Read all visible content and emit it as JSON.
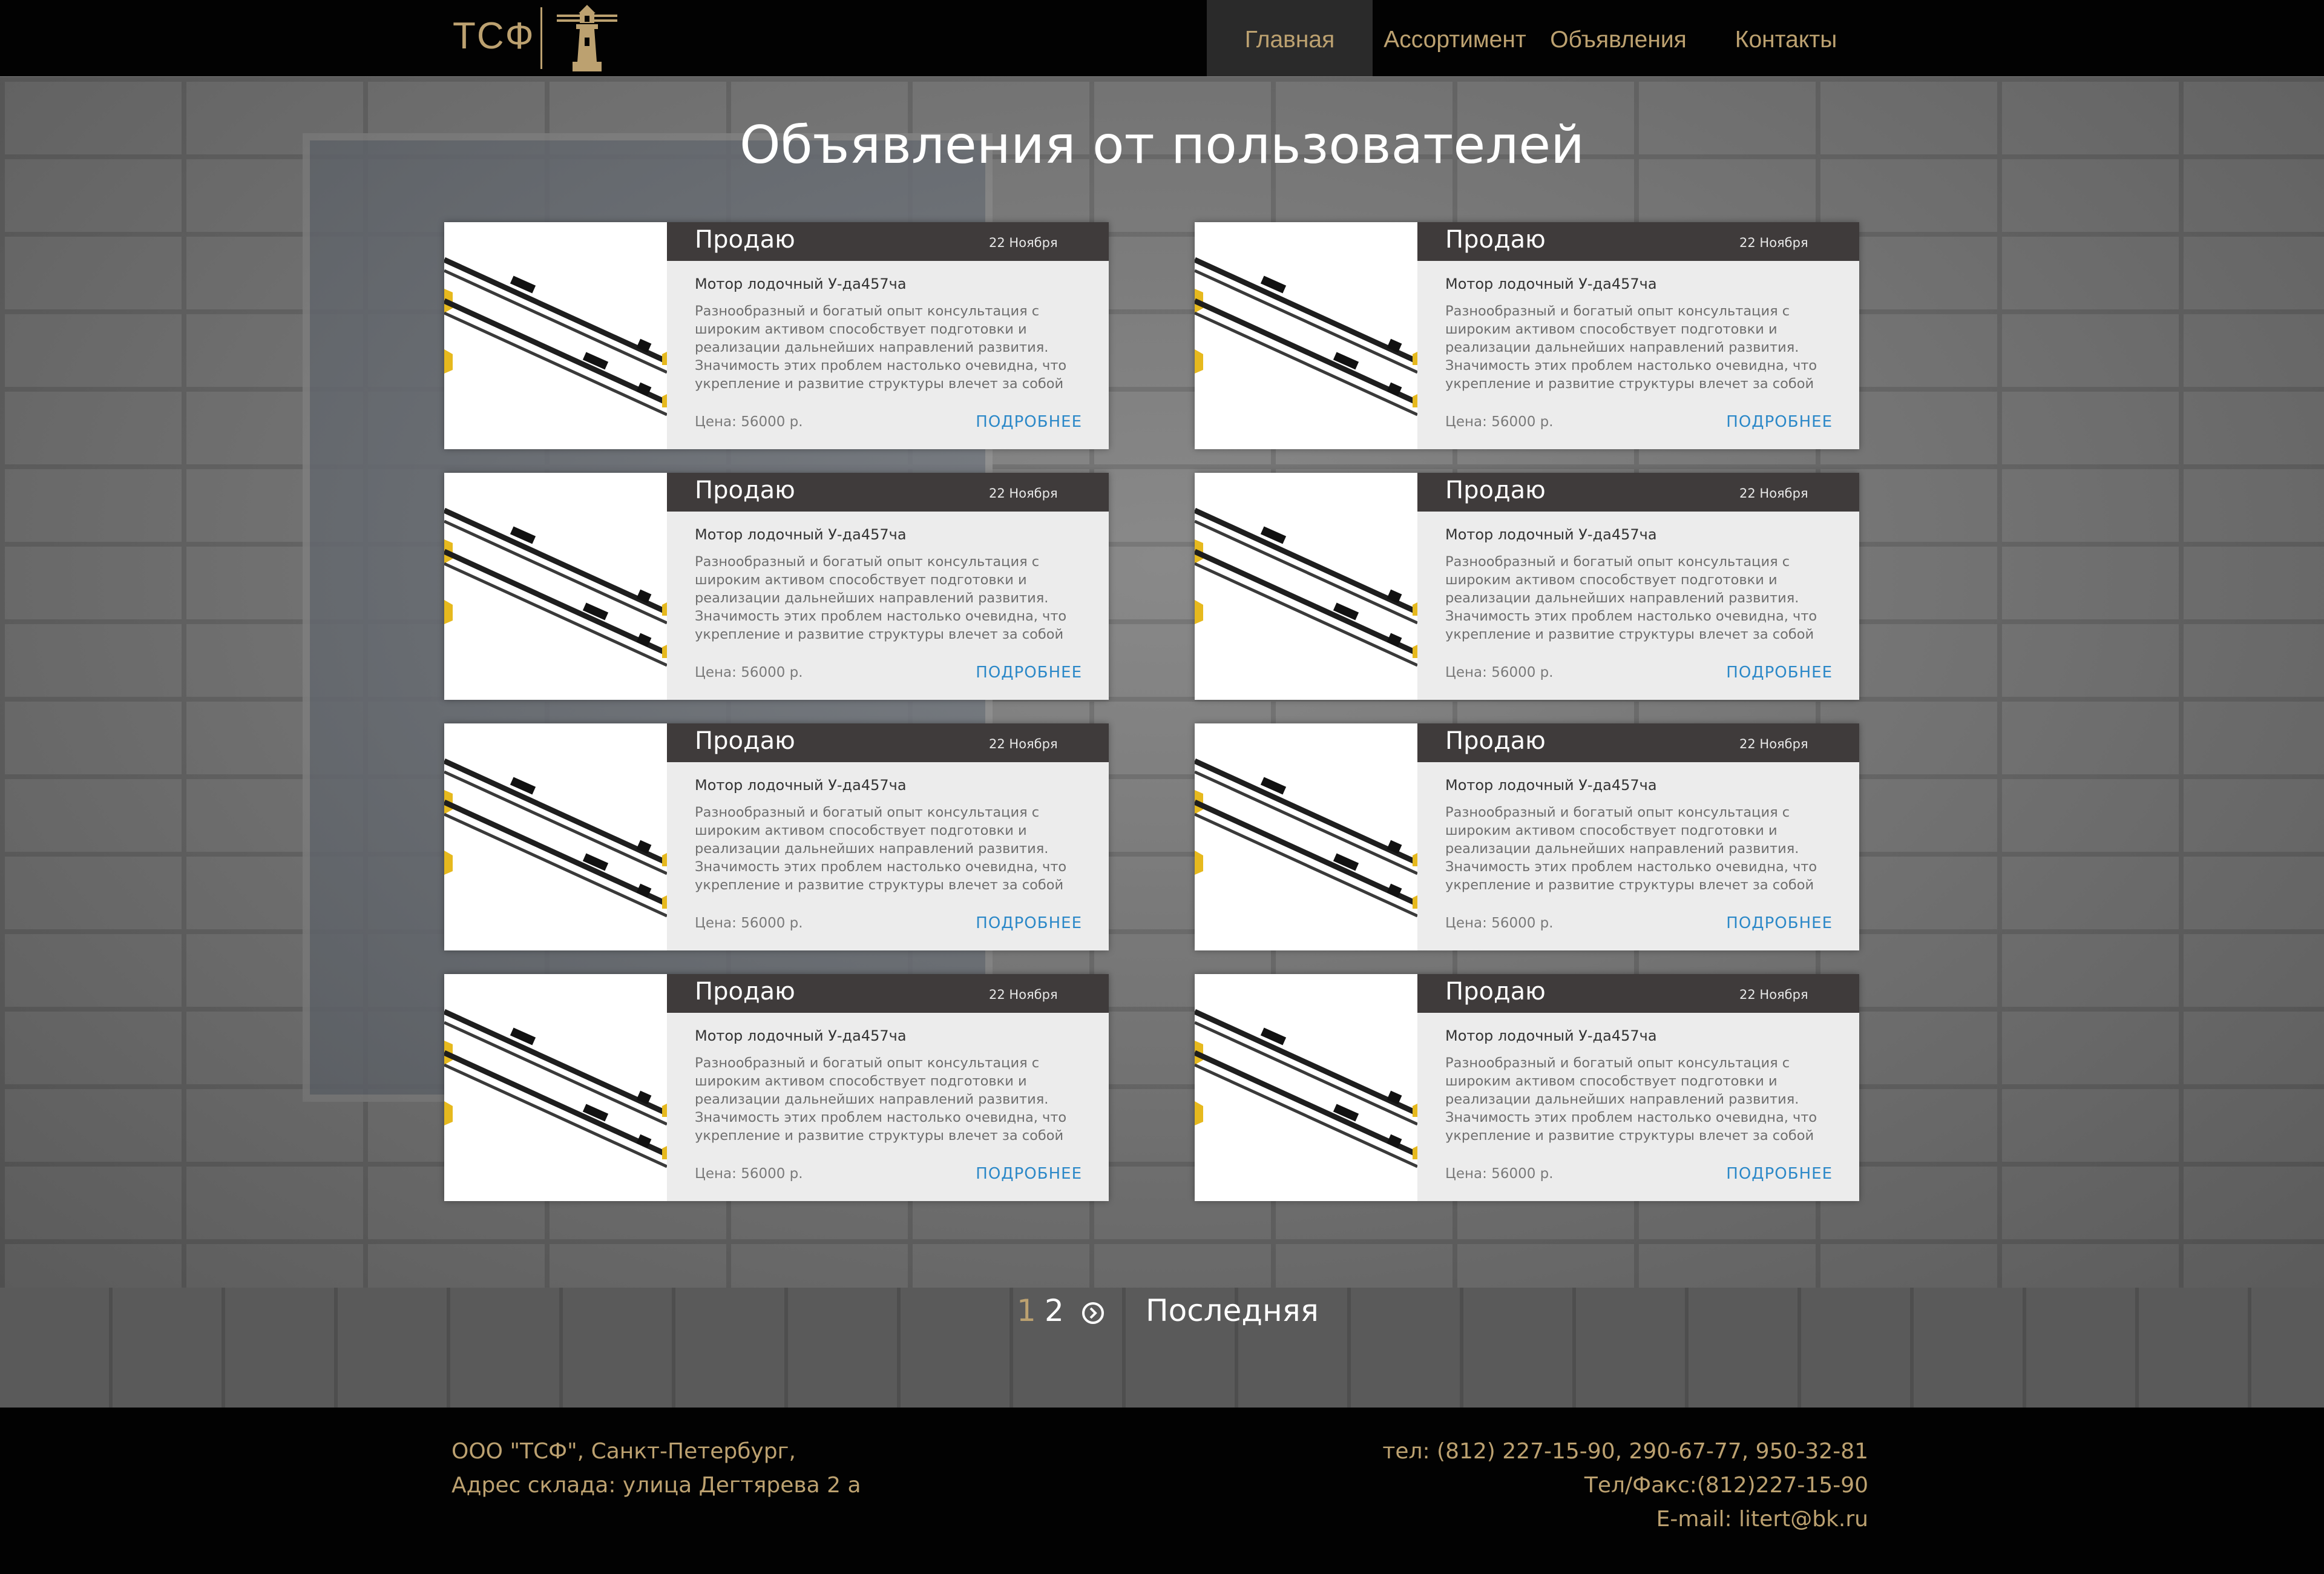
{
  "brand": {
    "logo_text": "ТСФ",
    "logo_icon": "lighthouse-icon",
    "accent_color": "#bca170"
  },
  "nav": {
    "items": [
      {
        "label": "Главная",
        "active": true
      },
      {
        "label": "Ассортимент",
        "active": false
      },
      {
        "label": "Объявления",
        "active": false
      },
      {
        "label": "Контакты",
        "active": false
      }
    ]
  },
  "page": {
    "title": "Объявления от пользователей"
  },
  "listings": [
    {
      "type": "Продаю",
      "date": "22 Ноября",
      "name": "Мотор лодочный У-да457ча",
      "description": "Разнообразный и богатый опыт консультация с широким активом способствует подготовки и реализации дальнейших направлений развития. Значимость этих проблем настолько очевидна, что укрепление и развитие структуры влечет за собой процесс внедрения и",
      "price": "Цена: 56000 р.",
      "more": "ПОДРОБНЕЕ"
    },
    {
      "type": "Продаю",
      "date": "22 Ноября",
      "name": "Мотор лодочный У-да457ча",
      "description": "Разнообразный и богатый опыт консультация с широким активом способствует подготовки и реализации дальнейших направлений развития. Значимость этих проблем настолько очевидна, что укрепление и развитие структуры влечет за собой процесс внедрения и",
      "price": "Цена: 56000 р.",
      "more": "ПОДРОБНЕЕ"
    },
    {
      "type": "Продаю",
      "date": "22 Ноября",
      "name": "Мотор лодочный У-да457ча",
      "description": "Разнообразный и богатый опыт консультация с широким активом способствует подготовки и реализации дальнейших направлений развития. Значимость этих проблем настолько очевидна, что укрепление и развитие структуры влечет за собой процесс внедрения и",
      "price": "Цена: 56000 р.",
      "more": "ПОДРОБНЕЕ"
    },
    {
      "type": "Продаю",
      "date": "22 Ноября",
      "name": "Мотор лодочный У-да457ча",
      "description": "Разнообразный и богатый опыт консультация с широким активом способствует подготовки и реализации дальнейших направлений развития. Значимость этих проблем настолько очевидна, что укрепление и развитие структуры влечет за собой процесс внедрения и",
      "price": "Цена: 56000 р.",
      "more": "ПОДРОБНЕЕ"
    },
    {
      "type": "Продаю",
      "date": "22 Ноября",
      "name": "Мотор лодочный У-да457ча",
      "description": "Разнообразный и богатый опыт консультация с широким активом способствует подготовки и реализации дальнейших направлений развития. Значимость этих проблем настолько очевидна, что укрепление и развитие структуры влечет за собой процесс внедрения и",
      "price": "Цена: 56000 р.",
      "more": "ПОДРОБНЕЕ"
    },
    {
      "type": "Продаю",
      "date": "22 Ноября",
      "name": "Мотор лодочный У-да457ча",
      "description": "Разнообразный и богатый опыт консультация с широким активом способствует подготовки и реализации дальнейших направлений развития. Значимость этих проблем настолько очевидна, что укрепление и развитие структуры влечет за собой процесс внедрения и",
      "price": "Цена: 56000 р.",
      "more": "ПОДРОБНЕЕ"
    },
    {
      "type": "Продаю",
      "date": "22 Ноября",
      "name": "Мотор лодочный У-да457ча",
      "description": "Разнообразный и богатый опыт консультация с широким активом способствует подготовки и реализации дальнейших направлений развития. Значимость этих проблем настолько очевидна, что укрепление и развитие структуры влечет за собой процесс внедрения и",
      "price": "Цена: 56000 р.",
      "more": "ПОДРОБНЕЕ"
    },
    {
      "type": "Продаю",
      "date": "22 Ноября",
      "name": "Мотор лодочный У-да457ча",
      "description": "Разнообразный и богатый опыт консультация с широким активом способствует подготовки и реализации дальнейших направлений развития. Значимость этих проблем настолько очевидна, что укрепление и развитие структуры влечет за собой процесс внедрения и",
      "price": "Цена: 56000 р.",
      "more": "ПОДРОБНЕЕ"
    }
  ],
  "pagination": {
    "current": "1",
    "page2": "2",
    "next_icon": "chevron-right-circle-icon",
    "last": "Последняя"
  },
  "footer": {
    "left": [
      "ООО \"ТСФ\", Санкт-Петербург,",
      "Адрес склада: улица Дегтярева 2 а"
    ],
    "right": [
      "тел: (812) 227-15-90, 290-67-77, 950-32-81",
      "Тел/Факс:(812)227-15-90",
      "E-mail: litert@bk.ru"
    ]
  }
}
